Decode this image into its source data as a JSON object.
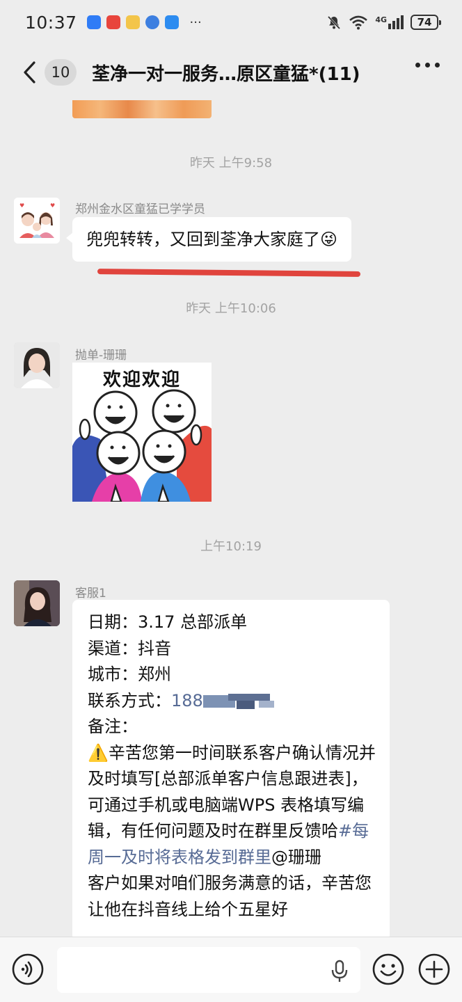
{
  "status_bar": {
    "time": "10:37",
    "more": "···",
    "network": "4G",
    "battery": "74"
  },
  "nav": {
    "unread_count": "10",
    "title": "荃净一对一服务…原区童猛*(11)"
  },
  "messages": [
    {
      "type": "timestamp",
      "text": "昨天 上午9:58"
    },
    {
      "type": "text",
      "sender": "郑州金水区童猛已学学员",
      "text": "兜兜转转，又回到荃净大家庭了😜"
    },
    {
      "type": "timestamp",
      "text": "昨天 上午10:06"
    },
    {
      "type": "sticker",
      "sender": "抛单-珊珊",
      "caption": "欢迎欢迎"
    },
    {
      "type": "timestamp",
      "text": "上午10:19"
    },
    {
      "type": "order",
      "sender": "客服1"
    }
  ],
  "order": {
    "date_label": "日期：",
    "date_value": "3.17 总部派单",
    "channel_label": "渠道：",
    "channel_value": "抖音",
    "city_label": "城市：",
    "city_value": "郑州",
    "contact_label": "联系方式：",
    "contact_value": "188",
    "note_label": "备注：",
    "note_body": "⚠️辛苦您第一时间联系客户确认情况并及时填写[总部派单客户信息跟进表]，可通过手机或电脑端WPS 表格填写编辑，有任何问题及时在群里反馈哈",
    "note_hashtag": "#每周一及时将表格发到群里",
    "note_mention": "@珊珊",
    "note_tail": "客户如果对咱们服务满意的话，辛苦您让他在抖音线上给个五星好"
  },
  "colors": {
    "background": "#ededed",
    "bubble": "#ffffff",
    "link": "#576b95",
    "underline_mark": "#e0443d"
  }
}
